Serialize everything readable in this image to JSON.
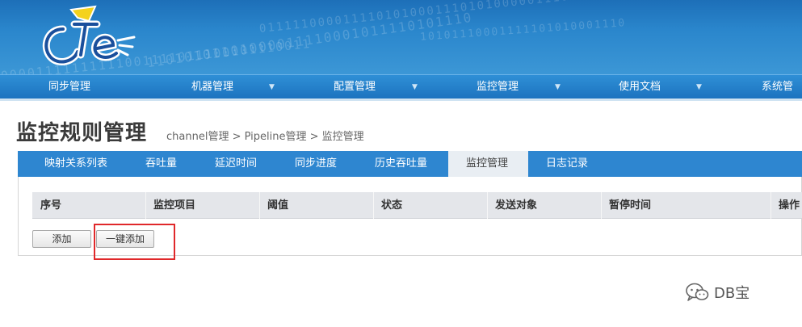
{
  "banner": {
    "binary_lines": [
      "0111110000111101010001110101000001110",
      "11010101101000011110001011110101110",
      "00001111111111001111011100101110011",
      "10101110001111101010001110"
    ]
  },
  "main_nav": [
    {
      "label": "同步管理",
      "has_dropdown": false
    },
    {
      "label": "机器管理",
      "has_dropdown": true
    },
    {
      "label": "配置管理",
      "has_dropdown": true
    },
    {
      "label": "监控管理",
      "has_dropdown": true
    },
    {
      "label": "使用文档",
      "has_dropdown": true
    },
    {
      "label": "系统管理",
      "has_dropdown": false
    }
  ],
  "dropdown_glyph": "▼",
  "page": {
    "title": "监控规则管理",
    "breadcrumb": "channel管理 > Pipeline管理 > 监控管理"
  },
  "sub_tabs": [
    {
      "label": "映射关系列表",
      "active": false
    },
    {
      "label": "吞吐量",
      "active": false
    },
    {
      "label": "延迟时间",
      "active": false
    },
    {
      "label": "同步进度",
      "active": false
    },
    {
      "label": "历史吞吐量",
      "active": false
    },
    {
      "label": "监控管理",
      "active": true
    },
    {
      "label": "日志记录",
      "active": false
    }
  ],
  "table": {
    "columns": [
      "序号",
      "监控项目",
      "阈值",
      "状态",
      "发送对象",
      "暂停时间",
      "操作"
    ],
    "rows": []
  },
  "buttons": {
    "add": "添加",
    "one_click_add": "一键添加"
  },
  "watermark": {
    "text": "DB宝",
    "icon": "wechat-icon"
  },
  "colors": {
    "nav_blue": "#1c73bf",
    "tab_blue": "#2e86d0",
    "highlight_red": "#e0282a"
  }
}
